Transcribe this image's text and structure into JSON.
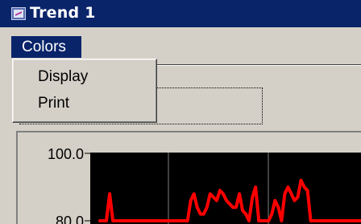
{
  "window": {
    "title": "Trend 1",
    "icon": "trend-window-icon"
  },
  "menubar": {
    "items": [
      {
        "label": "Colors",
        "active": true
      }
    ]
  },
  "dropdown": {
    "items": [
      {
        "label": "Display"
      },
      {
        "label": "Print"
      }
    ]
  },
  "chart_data": {
    "type": "line",
    "y_tick_labels": [
      "100.0",
      "80.0"
    ],
    "ylim": [
      80,
      100
    ],
    "background": "#000000",
    "grid": true,
    "series": [
      {
        "color": "#ff0000",
        "x": [
          0,
          4,
          6,
          8,
          10,
          12,
          14,
          16,
          18,
          20,
          22,
          24,
          26,
          28,
          30,
          32,
          34,
          36,
          38,
          40,
          42,
          44,
          46,
          48,
          50,
          52,
          54,
          56,
          58,
          60,
          62,
          64,
          66,
          68,
          70,
          72,
          74,
          76,
          78,
          80,
          82,
          84,
          86,
          88,
          90,
          92,
          94,
          96,
          98,
          100,
          102,
          104,
          106,
          108,
          110,
          112,
          114,
          116,
          118,
          120,
          122,
          124,
          126,
          128,
          130,
          132,
          134,
          136,
          138,
          140,
          142,
          144,
          146,
          148,
          150,
          152,
          154,
          156,
          158,
          160,
          162
        ],
        "y": [
          80,
          80,
          88,
          80,
          80,
          80,
          80,
          80,
          80,
          80,
          80,
          80,
          80,
          80,
          80,
          80,
          80,
          80,
          80,
          80,
          80,
          80,
          80,
          80,
          80,
          80,
          80,
          86,
          88,
          84,
          82,
          82,
          84,
          88,
          87,
          86,
          89,
          88,
          86,
          85,
          84,
          84,
          88,
          83,
          82,
          80,
          87,
          90,
          80,
          80,
          80,
          80,
          82,
          86,
          84,
          80,
          88,
          90,
          88,
          86,
          87,
          92,
          90,
          89,
          80,
          80,
          80,
          80,
          80,
          80,
          80,
          80,
          80,
          80,
          80,
          80,
          80,
          80,
          80,
          80,
          80
        ]
      }
    ]
  },
  "colors": {
    "titlebar": "#0a246a",
    "face": "#d4d0c8",
    "plot_bg": "#000000",
    "trend_line": "#ff0000",
    "grid": "#808080"
  }
}
